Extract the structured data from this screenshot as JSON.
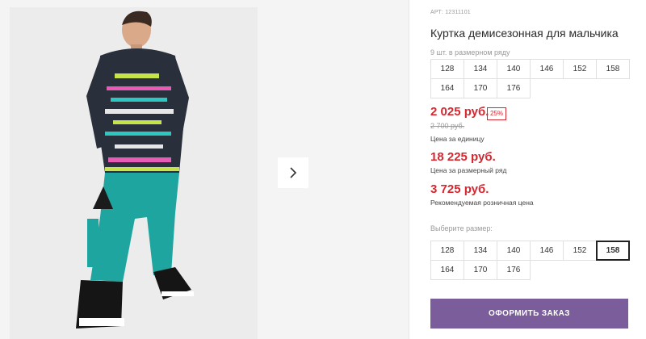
{
  "product": {
    "article": "АРТ: 12311101",
    "title": "Куртка демисезонная для мальчика",
    "pack_note": "9 шт. в размерном ряду",
    "sizes_in_pack": [
      "128",
      "134",
      "140",
      "146",
      "152",
      "158",
      "164",
      "170",
      "176"
    ]
  },
  "pricing": {
    "price_unit": "2 025 руб.",
    "discount": "25%",
    "price_old": "2 700 руб.",
    "label_unit": "Цена за единицу",
    "price_size_row": "18 225 руб.",
    "label_size_row": "Цена за размерный ряд",
    "price_rrp": "3 725 руб.",
    "label_rrp": "Рекомендуемая розничная цена"
  },
  "size_picker": {
    "label": "Выберите размер:",
    "options": [
      "128",
      "134",
      "140",
      "146",
      "152",
      "158",
      "164",
      "170",
      "176"
    ],
    "selected": "158"
  },
  "actions": {
    "order_label": "ОФОРМИТЬ ЗАКАЗ",
    "next_icon": "chevron-right-icon"
  },
  "colors": {
    "price": "#d8262f",
    "button": "#7a5d9a",
    "pants": "#1fa5a0",
    "jacket": "#2a2f3c"
  }
}
